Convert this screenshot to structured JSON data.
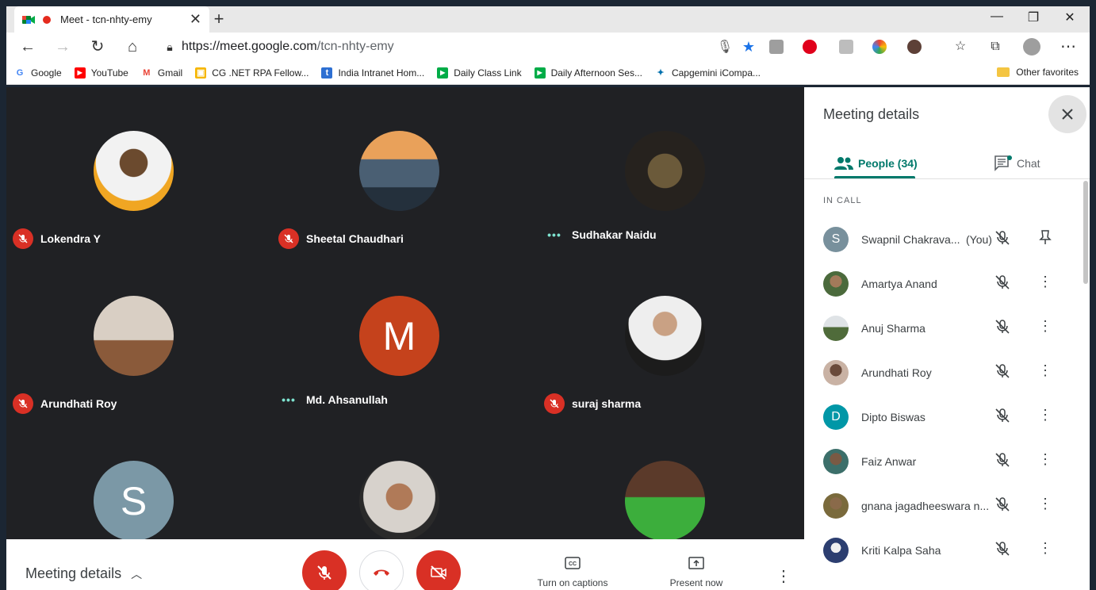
{
  "browser": {
    "tab_title": "Meet - tcn-nhty-emy",
    "tab_close": "✕",
    "new_tab": "+",
    "url_host": "https://meet.google.com",
    "url_path": "/tcn-nhty-emy"
  },
  "bookmarks": [
    {
      "label": "Google",
      "icon": "google-icon",
      "color": "#4285f4",
      "glyph": "G"
    },
    {
      "label": "YouTube",
      "icon": "youtube-icon",
      "color": "#ff0000",
      "glyph": "▶"
    },
    {
      "label": "Gmail",
      "icon": "gmail-icon",
      "color": "#ea4335",
      "glyph": "M"
    },
    {
      "label": "CG .NET RPA Fellow...",
      "icon": "classroom-icon",
      "color": "#f6b600",
      "glyph": "▣"
    },
    {
      "label": "India Intranet Hom...",
      "icon": "intranet-icon",
      "color": "#2d6fd2",
      "glyph": "t"
    },
    {
      "label": "Daily Class Link",
      "icon": "meet-icon",
      "color": "#00ac47",
      "glyph": "▶"
    },
    {
      "label": "Daily Afternoon Ses...",
      "icon": "meet-icon",
      "color": "#00ac47",
      "glyph": "▶"
    },
    {
      "label": "Capgemini iCompa...",
      "icon": "capgemini-icon",
      "color": "#0070ad",
      "glyph": "✦"
    }
  ],
  "other_favorites": "Other favorites",
  "tiles": [
    {
      "name": "Lokendra Y",
      "status": "muted",
      "avatar_color": "#d8c7b0",
      "initial": ""
    },
    {
      "name": "Sheetal Chaudhari",
      "status": "muted",
      "avatar_color": "#5a6f86",
      "initial": ""
    },
    {
      "name": "Sudhakar Naidu",
      "status": "speaking",
      "avatar_color": "#2a2622",
      "initial": ""
    },
    {
      "name": "Arundhati Roy",
      "status": "muted",
      "avatar_color": "#b59a86",
      "initial": ""
    },
    {
      "name": "Md. Ahsanullah",
      "status": "speaking",
      "avatar_color": "#c5421c",
      "initial": "M"
    },
    {
      "name": "suraj sharma",
      "status": "muted",
      "avatar_color": "#8a8a8a",
      "initial": ""
    },
    {
      "name": "",
      "status": "",
      "avatar_color": "#7b98a6",
      "initial": "S"
    },
    {
      "name": "",
      "status": "",
      "avatar_color": "#9e8b7a",
      "initial": ""
    },
    {
      "name": "",
      "status": "",
      "avatar_color": "#3b5d3a",
      "initial": ""
    }
  ],
  "controls": {
    "meeting_details": "Meeting details",
    "captions": "Turn on captions",
    "present": "Present now"
  },
  "panel": {
    "title": "Meeting details",
    "people_tab": "People (34)",
    "chat_tab": "Chat",
    "section": "IN CALL",
    "participants": [
      {
        "name": "Swapnil Chakrava...",
        "you": "(You)",
        "initial": "S",
        "color": "#78909c"
      },
      {
        "name": "Amartya Anand",
        "you": "",
        "initial": "",
        "color": "#4b6a3c"
      },
      {
        "name": "Anuj Sharma",
        "you": "",
        "initial": "",
        "color": "#5c7a4a"
      },
      {
        "name": "Arundhati Roy",
        "you": "",
        "initial": "",
        "color": "#a58c7c"
      },
      {
        "name": "Dipto Biswas",
        "you": "",
        "initial": "D",
        "color": "#0097a7"
      },
      {
        "name": "Faiz Anwar",
        "you": "",
        "initial": "",
        "color": "#3c6f6a"
      },
      {
        "name": "gnana jagadheeswara n...",
        "you": "",
        "initial": "",
        "color": "#7a6a3c"
      },
      {
        "name": "Kriti Kalpa Saha",
        "you": "",
        "initial": "",
        "color": "#2c3e70"
      }
    ]
  }
}
